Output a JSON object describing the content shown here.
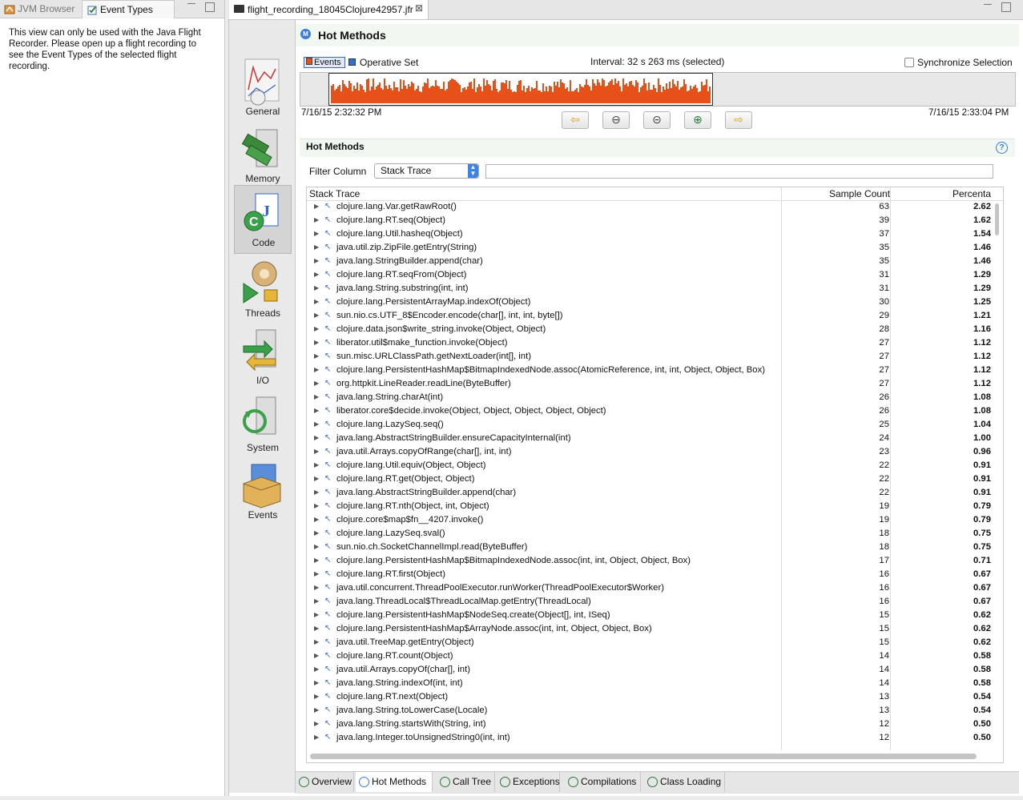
{
  "left_panel": {
    "tabs": [
      {
        "label": "JVM Browser",
        "icon": "jvm-browser-icon"
      },
      {
        "label": "Event Types",
        "icon": "event-types-icon"
      }
    ],
    "info_text": "This view can only be used with the Java Flight Recorder. Please open up a flight recording to see the Event Types of the selected flight recording."
  },
  "editor": {
    "tab_label": "flight_recording_18045Clojure42957.jfr"
  },
  "nav": {
    "items": [
      {
        "label": "General",
        "icon": "general-chart-icon"
      },
      {
        "label": "Memory",
        "icon": "memory-icon"
      },
      {
        "label": "Code",
        "icon": "code-icon",
        "selected": true
      },
      {
        "label": "Threads",
        "icon": "threads-icon"
      },
      {
        "label": "I/O",
        "icon": "io-icon"
      },
      {
        "label": "System",
        "icon": "system-icon"
      },
      {
        "label": "Events",
        "icon": "events-icon"
      }
    ]
  },
  "main": {
    "title": "Hot Methods",
    "legend_events": "Events",
    "legend_opset": "Operative Set",
    "interval": "Interval: 32 s 263 ms (selected)",
    "sync_label": "Synchronize Selection",
    "timeline_start": "7/16/15 2:32:32 PM",
    "timeline_end": "7/16/15 2:33:04 PM",
    "accent_color": "#e8501a",
    "nav_buttons": [
      "arrow-left-icon",
      "zoom-out-icon",
      "zoom-selection-icon",
      "zoom-in-icon",
      "arrow-right-icon"
    ]
  },
  "section": {
    "title": "Hot Methods",
    "filter_label": "Filter Column",
    "filter_selected": "Stack Trace",
    "filter_value": ""
  },
  "table": {
    "columns": [
      "Stack Trace",
      "Sample Count",
      "Percenta"
    ],
    "rows": [
      {
        "method": "clojure.lang.Var.getRawRoot()",
        "count": "63",
        "percent": "2.62"
      },
      {
        "method": "clojure.lang.RT.seq(Object)",
        "count": "39",
        "percent": "1.62"
      },
      {
        "method": "clojure.lang.Util.hasheq(Object)",
        "count": "37",
        "percent": "1.54"
      },
      {
        "method": "java.util.zip.ZipFile.getEntry(String)",
        "count": "35",
        "percent": "1.46"
      },
      {
        "method": "java.lang.StringBuilder.append(char)",
        "count": "35",
        "percent": "1.46"
      },
      {
        "method": "clojure.lang.RT.seqFrom(Object)",
        "count": "31",
        "percent": "1.29"
      },
      {
        "method": "java.lang.String.substring(int, int)",
        "count": "31",
        "percent": "1.29"
      },
      {
        "method": "clojure.lang.PersistentArrayMap.indexOf(Object)",
        "count": "30",
        "percent": "1.25"
      },
      {
        "method": "sun.nio.cs.UTF_8$Encoder.encode(char[], int, int, byte[])",
        "count": "29",
        "percent": "1.21"
      },
      {
        "method": "clojure.data.json$write_string.invoke(Object, Object)",
        "count": "28",
        "percent": "1.16"
      },
      {
        "method": "liberator.util$make_function.invoke(Object)",
        "count": "27",
        "percent": "1.12"
      },
      {
        "method": "sun.misc.URLClassPath.getNextLoader(int[], int)",
        "count": "27",
        "percent": "1.12"
      },
      {
        "method": "clojure.lang.PersistentHashMap$BitmapIndexedNode.assoc(AtomicReference, int, int, Object, Object, Box)",
        "count": "27",
        "percent": "1.12"
      },
      {
        "method": "org.httpkit.LineReader.readLine(ByteBuffer)",
        "count": "27",
        "percent": "1.12"
      },
      {
        "method": "java.lang.String.charAt(int)",
        "count": "26",
        "percent": "1.08"
      },
      {
        "method": "liberator.core$decide.invoke(Object, Object, Object, Object, Object)",
        "count": "26",
        "percent": "1.08"
      },
      {
        "method": "clojure.lang.LazySeq.seq()",
        "count": "25",
        "percent": "1.04"
      },
      {
        "method": "java.lang.AbstractStringBuilder.ensureCapacityInternal(int)",
        "count": "24",
        "percent": "1.00"
      },
      {
        "method": "java.util.Arrays.copyOfRange(char[], int, int)",
        "count": "23",
        "percent": "0.96"
      },
      {
        "method": "clojure.lang.Util.equiv(Object, Object)",
        "count": "22",
        "percent": "0.91"
      },
      {
        "method": "clojure.lang.RT.get(Object, Object)",
        "count": "22",
        "percent": "0.91"
      },
      {
        "method": "java.lang.AbstractStringBuilder.append(char)",
        "count": "22",
        "percent": "0.91"
      },
      {
        "method": "clojure.lang.RT.nth(Object, int, Object)",
        "count": "19",
        "percent": "0.79"
      },
      {
        "method": "clojure.core$map$fn__4207.invoke()",
        "count": "19",
        "percent": "0.79"
      },
      {
        "method": "clojure.lang.LazySeq.sval()",
        "count": "18",
        "percent": "0.75"
      },
      {
        "method": "sun.nio.ch.SocketChannelImpl.read(ByteBuffer)",
        "count": "18",
        "percent": "0.75"
      },
      {
        "method": "clojure.lang.PersistentHashMap$BitmapIndexedNode.assoc(int, int, Object, Object, Box)",
        "count": "17",
        "percent": "0.71"
      },
      {
        "method": "clojure.lang.RT.first(Object)",
        "count": "16",
        "percent": "0.67"
      },
      {
        "method": "java.util.concurrent.ThreadPoolExecutor.runWorker(ThreadPoolExecutor$Worker)",
        "count": "16",
        "percent": "0.67"
      },
      {
        "method": "java.lang.ThreadLocal$ThreadLocalMap.getEntry(ThreadLocal)",
        "count": "16",
        "percent": "0.67"
      },
      {
        "method": "clojure.lang.PersistentHashMap$NodeSeq.create(Object[], int, ISeq)",
        "count": "15",
        "percent": "0.62"
      },
      {
        "method": "clojure.lang.PersistentHashMap$ArrayNode.assoc(int, int, Object, Object, Box)",
        "count": "15",
        "percent": "0.62"
      },
      {
        "method": "java.util.TreeMap.getEntry(Object)",
        "count": "15",
        "percent": "0.62"
      },
      {
        "method": "clojure.lang.RT.count(Object)",
        "count": "14",
        "percent": "0.58"
      },
      {
        "method": "java.util.Arrays.copyOf(char[], int)",
        "count": "14",
        "percent": "0.58"
      },
      {
        "method": "java.lang.String.indexOf(int, int)",
        "count": "14",
        "percent": "0.58"
      },
      {
        "method": "clojure.lang.RT.next(Object)",
        "count": "13",
        "percent": "0.54"
      },
      {
        "method": "java.lang.String.toLowerCase(Locale)",
        "count": "13",
        "percent": "0.54"
      },
      {
        "method": "java.lang.String.startsWith(String, int)",
        "count": "12",
        "percent": "0.50"
      },
      {
        "method": "java.lang.Integer.toUnsignedString0(int, int)",
        "count": "12",
        "percent": "0.50"
      }
    ]
  },
  "bottom_tabs": [
    {
      "label": "Overview",
      "selected": false
    },
    {
      "label": "Hot Methods",
      "selected": true
    },
    {
      "label": "Call Tree",
      "selected": false
    },
    {
      "label": "Exceptions",
      "selected": false
    },
    {
      "label": "Compilations",
      "selected": false
    },
    {
      "label": "Class Loading",
      "selected": false
    }
  ]
}
